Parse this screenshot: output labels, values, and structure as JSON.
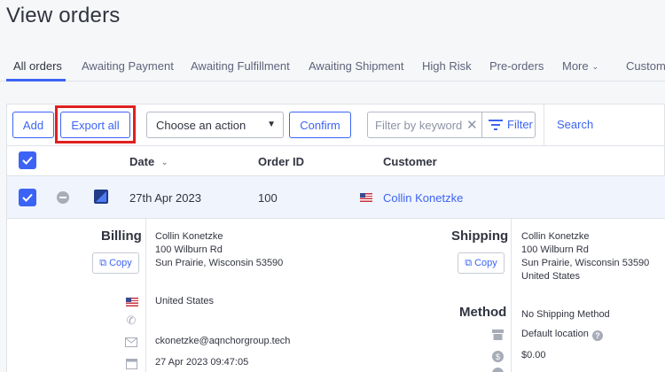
{
  "page": {
    "title": "View orders"
  },
  "tabs": [
    {
      "label": "All orders",
      "active": true
    },
    {
      "label": "Awaiting Payment"
    },
    {
      "label": "Awaiting Fulfillment"
    },
    {
      "label": "Awaiting Shipment"
    },
    {
      "label": "High Risk"
    },
    {
      "label": "Pre-orders"
    },
    {
      "label": "More"
    },
    {
      "label": "Custom"
    }
  ],
  "toolbar": {
    "add_label": "Add",
    "export_label": "Export all",
    "action_select_value": "Choose an action",
    "confirm_label": "Confirm",
    "filter_placeholder": "Filter by keyword",
    "filter_label": "Filter",
    "search_label": "Search"
  },
  "table": {
    "columns": {
      "date": "Date",
      "order_id": "Order ID",
      "customer": "Customer"
    }
  },
  "order": {
    "date": "27th Apr 2023",
    "order_id": "100",
    "customer": "Collin Konetzke"
  },
  "billing": {
    "title": "Billing",
    "copy_label": "Copy",
    "name": "Collin Konetzke",
    "street": "100 Wilburn Rd",
    "city_line": "Sun Prairie, Wisconsin 53590",
    "country": "United States",
    "email": "ckonetzke@aqnchorgroup.tech",
    "date": "27 Apr 2023 09:47:05"
  },
  "shipping": {
    "title": "Shipping",
    "copy_label": "Copy",
    "name": "Collin Konetzke",
    "street": "100 Wilburn Rd",
    "city_line": "Sun Prairie, Wisconsin 53590",
    "country": "United States",
    "method_title": "Method",
    "method": "No Shipping Method",
    "location": "Default location",
    "cost": "$0.00"
  },
  "colors": {
    "accent": "#3c64f4",
    "highlight": "#e02020"
  }
}
